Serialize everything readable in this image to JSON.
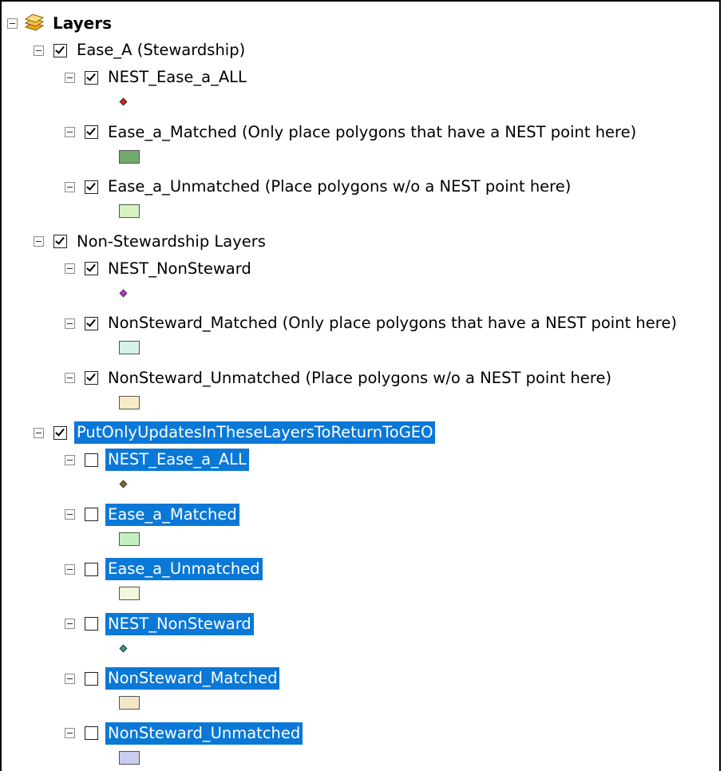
{
  "toc": {
    "root": {
      "label": "Layers",
      "icon": "layers-stack-icon"
    },
    "groups": [
      {
        "label": "Ease_A (Stewardship)",
        "checked": true,
        "selected": false,
        "layers": [
          {
            "label": "NEST_Ease_a_ALL",
            "checked": true,
            "selected": false,
            "symbol": "point",
            "color": "#e02020"
          },
          {
            "label": "Ease_a_Matched (Only place polygons that have a NEST point here)",
            "checked": true,
            "selected": false,
            "symbol": "polygon",
            "color": "#72aa6e"
          },
          {
            "label": "Ease_a_Unmatched (Place polygons w/o a NEST point here)",
            "checked": true,
            "selected": false,
            "symbol": "polygon",
            "color": "#d8f2c0"
          }
        ]
      },
      {
        "label": "Non-Stewardship Layers",
        "checked": true,
        "selected": false,
        "layers": [
          {
            "label": "NEST_NonSteward",
            "checked": true,
            "selected": false,
            "symbol": "point",
            "color": "#c832d8"
          },
          {
            "label": "NonSteward_Matched (Only place polygons that have a NEST point here)",
            "checked": true,
            "selected": false,
            "symbol": "polygon",
            "color": "#d4f2ea"
          },
          {
            "label": "NonSteward_Unmatched (Place polygons w/o a NEST point here)",
            "checked": true,
            "selected": false,
            "symbol": "polygon",
            "color": "#f6ecc4"
          }
        ]
      },
      {
        "label": "PutOnlyUpdatesInTheseLayersToReturnToGEO",
        "checked": true,
        "selected": true,
        "layers": [
          {
            "label": "NEST_Ease_a_ALL",
            "checked": false,
            "selected": true,
            "symbol": "point",
            "color": "#8c6a1c"
          },
          {
            "label": "Ease_a_Matched",
            "checked": false,
            "selected": true,
            "symbol": "polygon",
            "color": "#c4f0c0"
          },
          {
            "label": "Ease_a_Unmatched",
            "checked": false,
            "selected": true,
            "symbol": "polygon",
            "color": "#f2f6da"
          },
          {
            "label": "NEST_NonSteward",
            "checked": false,
            "selected": true,
            "symbol": "point",
            "color": "#2c9a9a"
          },
          {
            "label": "NonSteward_Matched",
            "checked": false,
            "selected": true,
            "symbol": "polygon",
            "color": "#f2e6c8"
          },
          {
            "label": "NonSteward_Unmatched",
            "checked": false,
            "selected": true,
            "symbol": "polygon",
            "color": "#c8cdf0"
          }
        ]
      }
    ]
  },
  "colors": {
    "selection": "#0a78d7",
    "selection_text": "#ffffff"
  }
}
